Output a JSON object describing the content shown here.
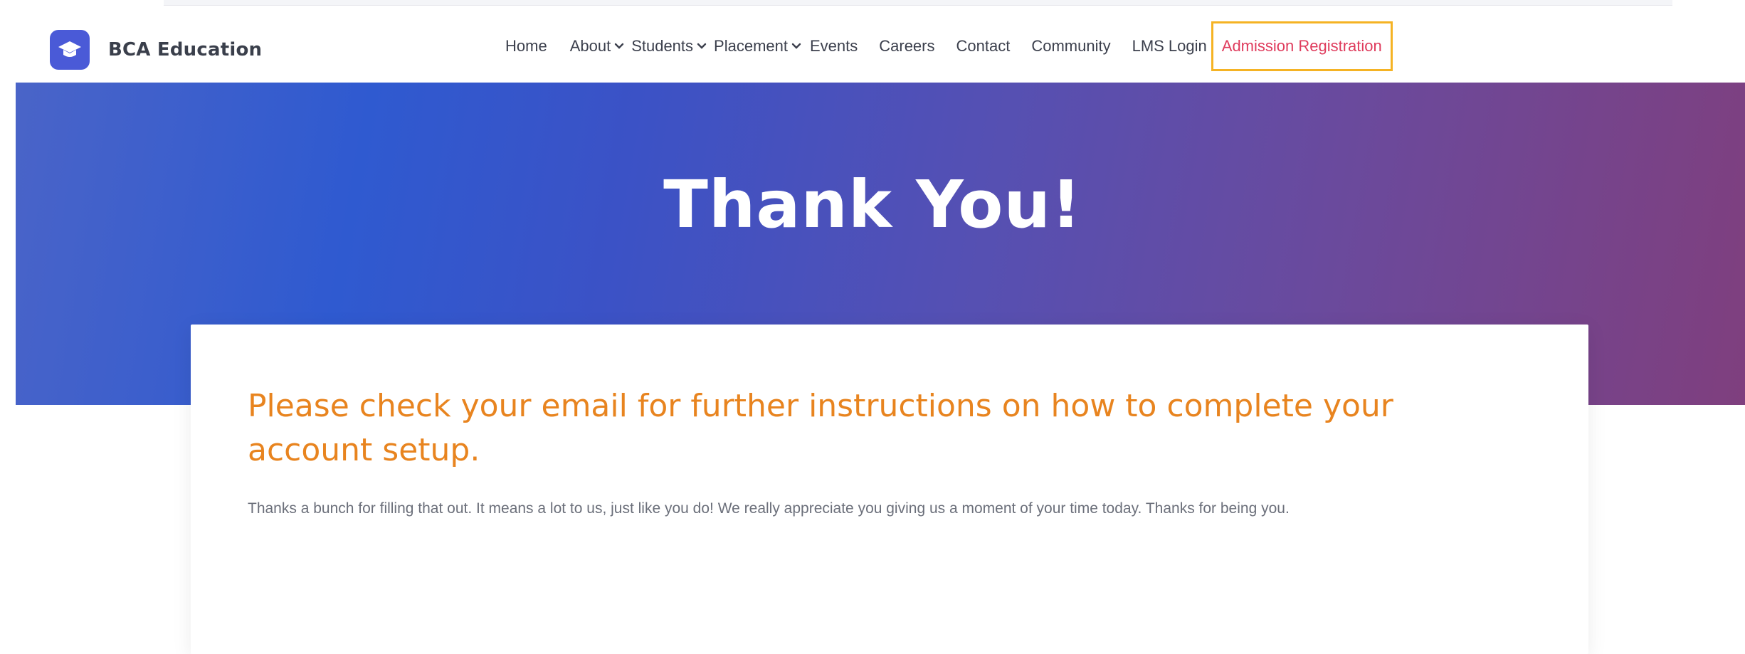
{
  "brand": {
    "name": "BCA Education",
    "logo_icon": "graduation-cap-icon",
    "logo_color": "#4a5ad7"
  },
  "nav": {
    "items": [
      {
        "label": "Home",
        "dropdown": false
      },
      {
        "label": "About",
        "dropdown": true
      },
      {
        "label": "Students",
        "dropdown": true
      },
      {
        "label": "Placement",
        "dropdown": true
      },
      {
        "label": "Events",
        "dropdown": false
      },
      {
        "label": "Careers",
        "dropdown": false
      },
      {
        "label": "Contact",
        "dropdown": false
      },
      {
        "label": "Community",
        "dropdown": false
      },
      {
        "label": "LMS Login",
        "dropdown": false
      }
    ],
    "highlight": {
      "label": "Admission Registration",
      "text_color": "#df3b5c",
      "border_color": "#f5b324"
    }
  },
  "hero": {
    "title": "Thank You!"
  },
  "card": {
    "heading": "Please check your email for further instructions on how to complete your account setup.",
    "heading_color": "#e8841f",
    "body": "Thanks a bunch for filling that out. It means a lot to us, just like you do! We really appreciate you giving us a moment of your time today. Thanks for being you."
  }
}
